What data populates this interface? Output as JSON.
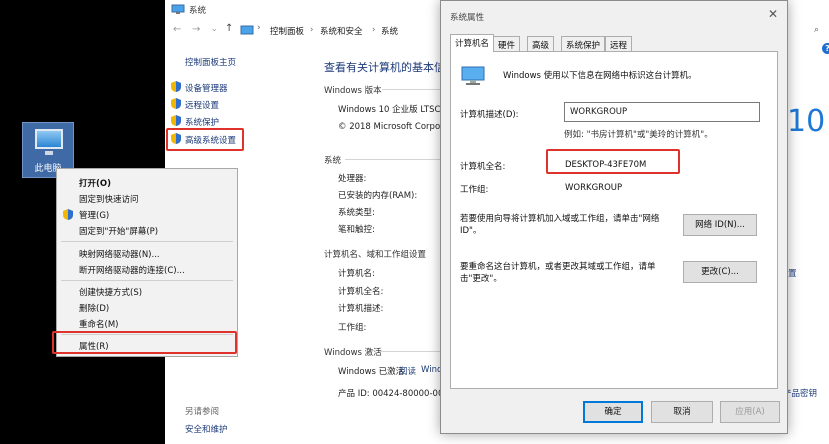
{
  "desktop": {
    "icon_label": "此电脑"
  },
  "context_menu": {
    "items": [
      "打开(O)",
      "固定到快速访问",
      "管理(G)",
      "固定到\"开始\"屏幕(P)",
      "映射网络驱动器(N)...",
      "断开网络驱动器的连接(C)...",
      "创建快捷方式(S)",
      "删除(D)",
      "重命名(M)",
      "属性(R)"
    ]
  },
  "system_window": {
    "title": "系统",
    "breadcrumb": [
      "控制面板",
      "系统和安全",
      "系统"
    ],
    "sidebar": {
      "home": "控制面板主页",
      "links": [
        "设备管理器",
        "远程设置",
        "系统保护",
        "高级系统设置"
      ],
      "see_also_title": "另请参阅",
      "see_also": [
        "安全和维护"
      ]
    },
    "heading": "查看有关计算机的基本信",
    "windows_edition": {
      "title": "Windows 版本",
      "edition": "Windows 10 企业版 LTSC",
      "copyright": "© 2018 Microsoft Corpor"
    },
    "system": {
      "title": "系统",
      "labels": [
        "处理器:",
        "已安装的内存(RAM):",
        "系统类型:",
        "笔和触控:"
      ]
    },
    "computer_name": {
      "title": "计算机名、域和工作组设置",
      "labels": [
        "计算机名:",
        "计算机全名:",
        "计算机描述:",
        "工作组:"
      ]
    },
    "activation": {
      "title": "Windows 激活",
      "status": "Windows 已激活",
      "read_link": "阅读",
      "read_link2": "Windows",
      "product_id": "产品 ID: 00424-80000-00"
    },
    "right_fragments": {
      "win10": "10",
      "change_settings": "置",
      "product_key": "产品密钥",
      "help": "?"
    }
  },
  "properties_dialog": {
    "title": "系统属性",
    "tabs": [
      "计算机名",
      "硬件",
      "高级",
      "系统保护",
      "远程"
    ],
    "info": "Windows 使用以下信息在网络中标识这台计算机。",
    "desc_label": "计算机描述(D):",
    "desc_value": "WORKGROUP",
    "example": "例如: \"书房计算机\"或\"美玲的计算机\"。",
    "full_name_label": "计算机全名:",
    "full_name_value": "DESKTOP-43FE70M",
    "workgroup_label": "工作组:",
    "workgroup_value": "WORKGROUP",
    "network_text": "若要使用向导将计算机加入域或工作组，请单击\"网络 ID\"。",
    "network_button": "网络 ID(N)...",
    "rename_text": "要重命名这台计算机，或者更改其域或工作组，请单击\"更改\"。",
    "change_button": "更改(C)...",
    "ok": "确定",
    "cancel": "取消",
    "apply": "应用(A)"
  }
}
